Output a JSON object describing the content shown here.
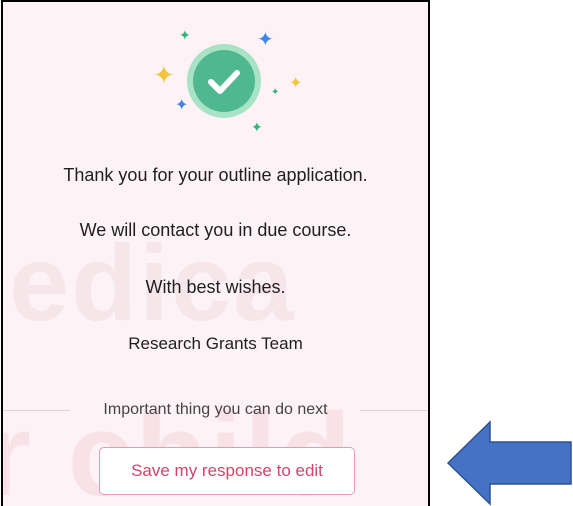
{
  "confirmation": {
    "icon": "check-circle-icon",
    "decoration": [
      "sparkle-icon"
    ],
    "messages": [
      "Thank you for your outline application.",
      "We will contact you in due course.",
      "With best wishes.",
      "Research Grants Team"
    ]
  },
  "watermark": {
    "line1": "edica",
    "line2": "r child"
  },
  "next_steps": {
    "heading": "Important thing you can do next",
    "save_button_label": "Save my response to edit"
  },
  "annotation": {
    "arrow": "left-arrow-icon",
    "arrow_color": "#4472c4"
  },
  "colors": {
    "accent": "#d2456c",
    "success": "#4fb891",
    "panel_background": "#fdf2f5"
  }
}
